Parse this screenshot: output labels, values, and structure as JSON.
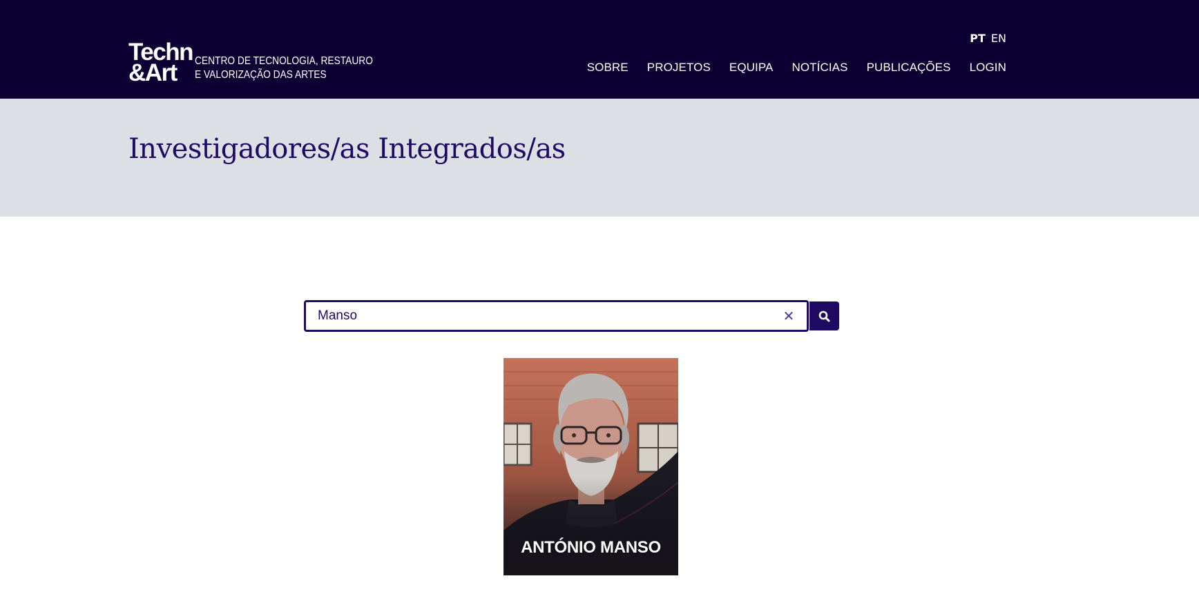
{
  "header": {
    "logo": {
      "mark_line1": "Techn",
      "mark_line2": "&Art",
      "subtitle_line1": "CENTRO DE TECNOLOGIA, RESTAURO",
      "subtitle_line2": "E VALORIZAÇÃO DAS ARTES"
    },
    "languages": [
      {
        "label": "PT",
        "active": true
      },
      {
        "label": "EN",
        "active": false
      }
    ],
    "nav": [
      {
        "label": "SOBRE"
      },
      {
        "label": "PROJETOS"
      },
      {
        "label": "EQUIPA"
      },
      {
        "label": "NOTÍCIAS"
      },
      {
        "label": "PUBLICAÇÕES"
      },
      {
        "label": "LOGIN"
      }
    ]
  },
  "banner": {
    "title": "Investigadores/as Integrados/as"
  },
  "search": {
    "value": "Manso",
    "clear_icon": "close-icon",
    "button_icon": "search-icon"
  },
  "results": [
    {
      "name": "ANTÓNIO MANSO"
    }
  ],
  "colors": {
    "header_bg": "#0d0033",
    "accent": "#1e0a63",
    "banner_bg": "#dcdfe3"
  }
}
